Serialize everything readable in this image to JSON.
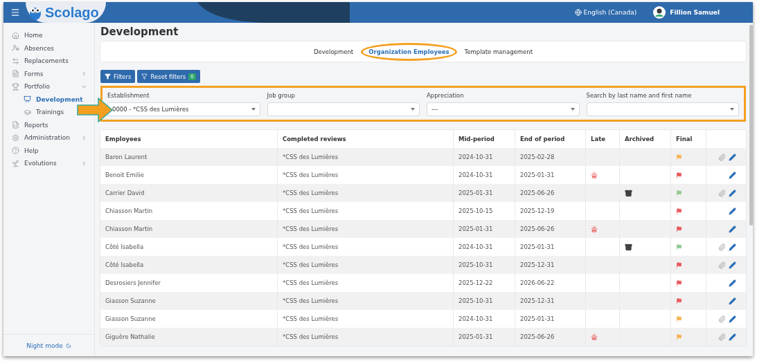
{
  "header": {
    "logo": "Scolago",
    "language": "English (Canada)",
    "user": "Fillion Samuel"
  },
  "sidebar": {
    "items": [
      {
        "label": "Home"
      },
      {
        "label": "Absences"
      },
      {
        "label": "Replacements"
      },
      {
        "label": "Forms",
        "expanded": false
      },
      {
        "label": "Portfolio",
        "expanded": true,
        "children": [
          {
            "label": "Development",
            "selected": true
          },
          {
            "label": "Trainings",
            "selected": false
          }
        ]
      },
      {
        "label": "Reports"
      },
      {
        "label": "Administration",
        "expanded": false
      },
      {
        "label": "Help"
      },
      {
        "label": "Evolutions",
        "expanded": false
      }
    ],
    "footer": "Night mode"
  },
  "page_title": "Development",
  "tabs": [
    {
      "label": "Development",
      "selected": false
    },
    {
      "label": "Organization Employees",
      "selected": true
    },
    {
      "label": "Template management",
      "selected": false
    }
  ],
  "toolbar": {
    "filters": "Filters",
    "reset": "Reset filters",
    "reset_count": "0"
  },
  "filters": [
    {
      "label": "Establishment",
      "value": "0000 - *CSS des Lumières"
    },
    {
      "label": "Job group"
    },
    {
      "label": "Appreciation",
      "value": "---"
    },
    {
      "label": "Search by last name and first name"
    }
  ],
  "table": {
    "columns": [
      "Employees",
      "Completed reviews",
      "Mid-period",
      "End of period",
      "Late",
      "Archived",
      "Final"
    ],
    "rows": [
      {
        "employee": "Baron Laurent",
        "reviews": "*CSS des Lumières",
        "mid": "2024-10-31",
        "end": "2025-02-28",
        "late": false,
        "archived": false,
        "color": "#f5b555",
        "attachment": true
      },
      {
        "employee": "Benoit Emilie",
        "reviews": "*CSS des Lumières",
        "mid": "2024-10-31",
        "end": "2025-01-31",
        "late": true,
        "archived": false,
        "color": "#e8595b",
        "attachment": false
      },
      {
        "employee": "Carrier David",
        "reviews": "*CSS des Lumières",
        "mid": "2025-01-31",
        "end": "2025-06-26",
        "late": false,
        "archived": true,
        "color": "#8fc98f",
        "attachment": true
      },
      {
        "employee": "Chiasson Martin",
        "reviews": "*CSS des Lumières",
        "mid": "2025-10-15",
        "end": "2025-12-19",
        "late": false,
        "archived": false,
        "color": "#e8595b",
        "attachment": false
      },
      {
        "employee": "Chiasson Martin",
        "reviews": "*CSS des Lumières",
        "mid": "2025-01-31",
        "end": "2025-06-26",
        "late": true,
        "archived": false,
        "color": "#e8595b",
        "attachment": false
      },
      {
        "employee": "Côté Isabella",
        "reviews": "*CSS des Lumières",
        "mid": "2024-10-31",
        "end": "2025-01-31",
        "late": false,
        "archived": true,
        "color": "#8fc98f",
        "attachment": true
      },
      {
        "employee": "Côté Isabella",
        "reviews": "*CSS des Lumières",
        "mid": "2025-10-31",
        "end": "2025-12-31",
        "late": false,
        "archived": false,
        "color": "#e8595b",
        "attachment": true
      },
      {
        "employee": "Desrosiers Jennifer",
        "reviews": "*CSS des Lumières",
        "mid": "2025-12-22",
        "end": "2026-06-22",
        "late": false,
        "archived": false,
        "color": "#e8595b",
        "attachment": false
      },
      {
        "employee": "Giasson Suzanne",
        "reviews": "*CSS des Lumières",
        "mid": "2025-10-31",
        "end": "2025-12-31",
        "late": false,
        "archived": false,
        "color": "#e8595b",
        "attachment": false
      },
      {
        "employee": "Giasson Suzanne",
        "reviews": "*CSS des Lumières",
        "mid": "2024-10-31",
        "end": "2025-01-31",
        "late": false,
        "archived": false,
        "color": "#f5b555",
        "attachment": true
      },
      {
        "employee": "Giguère Nathalie",
        "reviews": "*CSS des Lumières",
        "mid": "2025-01-31",
        "end": "2025-06-26",
        "late": true,
        "archived": false,
        "color": "#f5b555",
        "attachment": true
      }
    ]
  }
}
